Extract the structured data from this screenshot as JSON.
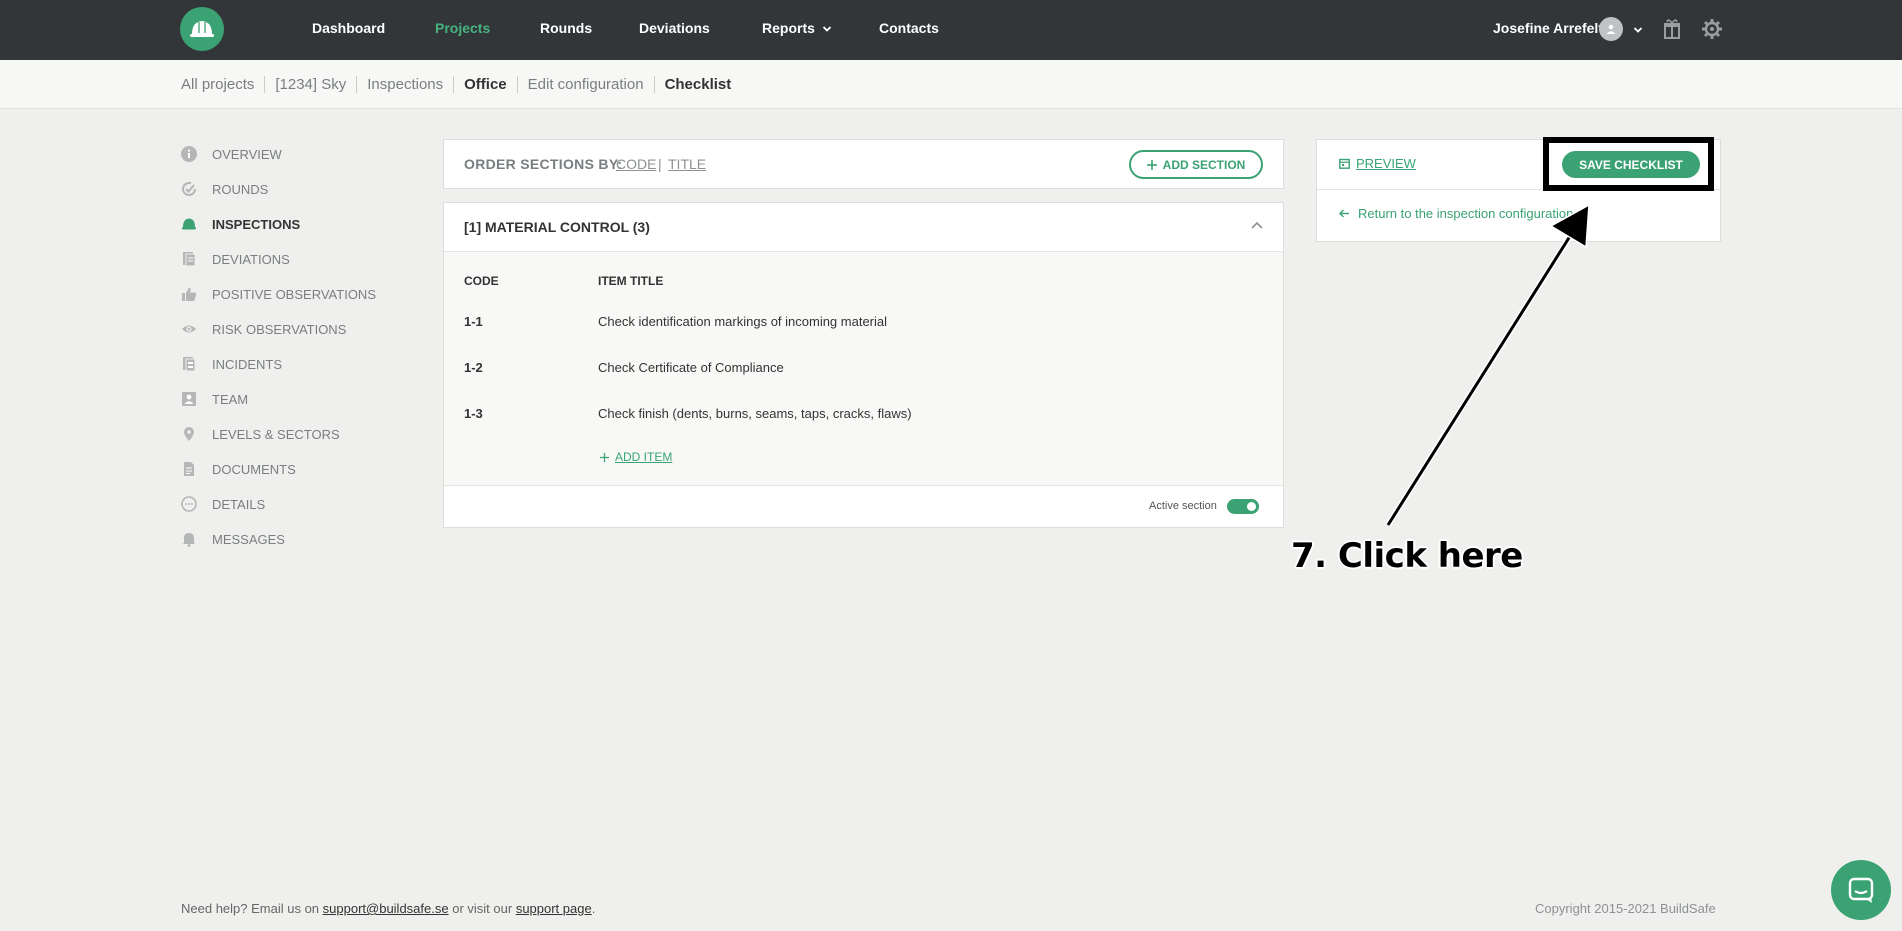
{
  "nav": {
    "items": [
      "Dashboard",
      "Projects",
      "Rounds",
      "Deviations",
      "Reports",
      "Contacts"
    ],
    "user_name": "Josefine Arrefelt"
  },
  "breadcrumb": [
    "All projects",
    "[1234] Sky",
    "Inspections",
    "Office",
    "Edit configuration",
    "Checklist"
  ],
  "sidebar": {
    "items": [
      {
        "label": "OVERVIEW",
        "icon": "info-icon"
      },
      {
        "label": "ROUNDS",
        "icon": "rounds-check-icon"
      },
      {
        "label": "INSPECTIONS",
        "icon": "helmet-icon"
      },
      {
        "label": "DEVIATIONS",
        "icon": "document-icon"
      },
      {
        "label": "POSITIVE OBSERVATIONS",
        "icon": "thumbs-up-icon"
      },
      {
        "label": "RISK OBSERVATIONS",
        "icon": "eye-icon"
      },
      {
        "label": "INCIDENTS",
        "icon": "clipboard-icon"
      },
      {
        "label": "TEAM",
        "icon": "team-card-icon"
      },
      {
        "label": "LEVELS & SECTORS",
        "icon": "location-pin-icon"
      },
      {
        "label": "DOCUMENTS",
        "icon": "file-icon"
      },
      {
        "label": "DETAILS",
        "icon": "more-circle-icon"
      },
      {
        "label": "MESSAGES",
        "icon": "bell-icon"
      }
    ]
  },
  "order": {
    "label": "ORDER SECTIONS BY:",
    "code": "CODE",
    "sep": "|",
    "title": "TITLE",
    "add_section": "ADD SECTION"
  },
  "section": {
    "title": "[1] MATERIAL CONTROL (3)",
    "col_code": "CODE",
    "col_title": "ITEM TITLE",
    "rows": [
      {
        "code": "1-1",
        "title": "Check identification markings of incoming material"
      },
      {
        "code": "1-2",
        "title": "Check Certificate of Compliance"
      },
      {
        "code": "1-3",
        "title": "Check finish (dents, burns, seams, taps, cracks, flaws)"
      }
    ],
    "add_item": "ADD ITEM",
    "active_label": "Active section",
    "active": true
  },
  "side_panel": {
    "preview": "PREVIEW",
    "save": "SAVE CHECKLIST",
    "return": "Return to the inspection configuration"
  },
  "annotation": {
    "label": "7. Click here"
  },
  "footer": {
    "help_prefix": "Need help? Email us on",
    "email": "support@buildsafe.se",
    "help_mid": "or visit our",
    "support_page": "support page",
    "help_end": ".",
    "copyright": "Copyright 2015-2021 BuildSafe"
  },
  "colors": {
    "brand_green": "#3aa273",
    "topbar": "#323639",
    "background": "#eff0ed"
  }
}
